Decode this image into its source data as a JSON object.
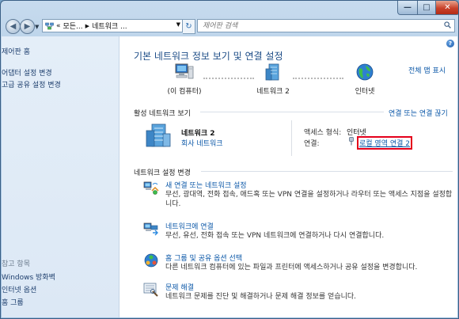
{
  "window": {
    "controls": {
      "minimize": "—",
      "maximize": "□",
      "close": "✕"
    }
  },
  "nav": {
    "back_glyph": "◀",
    "forward_glyph": "▶",
    "breadcrumb": [
      "«",
      "모든...",
      "네트워크 ..."
    ],
    "refresh_glyph": "↻",
    "search_placeholder": "제어판 검색"
  },
  "sidebar": {
    "links": [
      "제어판 홈",
      "어댑터 설정 변경",
      "고급 공유 설정 변경"
    ],
    "see_also_header": "참고 항목",
    "see_also": [
      "Windows 방화벽",
      "인터넷 옵션",
      "홈 그룹"
    ]
  },
  "main": {
    "help_glyph": "?",
    "title": "기본 네트워크 정보 보기 및 연결 설정",
    "view_full_map": "전체 맵 표시",
    "map_nodes": [
      "(이 컴퓨터)",
      "네트워크 2",
      "인터넷"
    ],
    "active_header": "활성 네트워크 보기",
    "connect_disconnect": "연결 또는 연결 끊기",
    "network": {
      "name": "네트워크 2",
      "type": "회사 네트워크",
      "access_label": "액세스 형식:",
      "access_value": "인터넷",
      "connections_label": "연결:",
      "connection": "로컬 영역 연결 2"
    },
    "change_header": "네트워크 설정 변경",
    "tasks": [
      {
        "icon": "new-connection-icon",
        "title": "새 연결 또는 네트워크 설정",
        "desc": "무선, 광대역, 전화 접속, 애드혹 또는 VPN 연결을 설정하거나 라우터 또는 액세스 지점을 설정합니다."
      },
      {
        "icon": "connect-network-icon",
        "title": "네트워크에 연결",
        "desc": "무선, 유선, 전화 접속 또는 VPN 네트워크에 연결하거나 다시 연결합니다."
      },
      {
        "icon": "homegroup-icon",
        "title": "홈 그룹 및 공유 옵션 선택",
        "desc": "다른 네트워크 컴퓨터에 있는 파일과 프린터에 액세스하거나 공유 설정을 변경합니다."
      },
      {
        "icon": "troubleshoot-icon",
        "title": "문제 해결",
        "desc": "네트워크 문제를 진단 및 해결하거나 문제 해결 정보를 얻습니다."
      }
    ]
  }
}
